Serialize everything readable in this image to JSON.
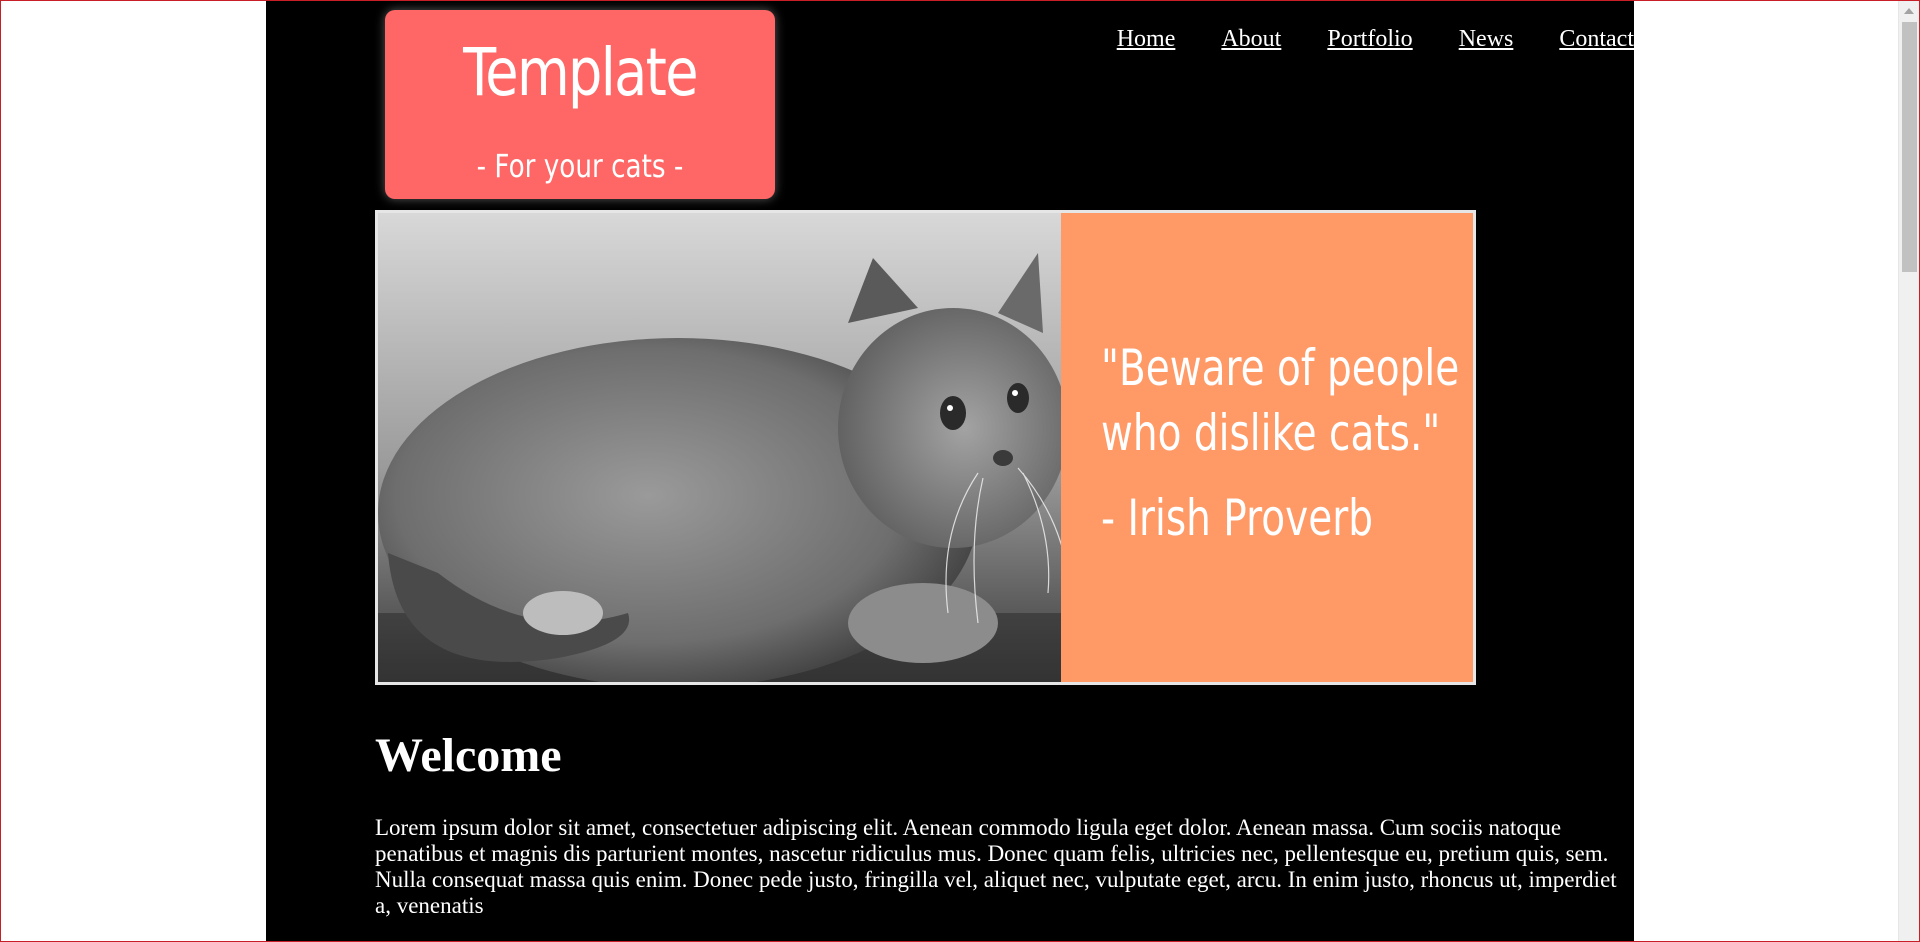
{
  "logo": {
    "title": "Template",
    "subtitle": "- For your cats -",
    "color": "#ff6666"
  },
  "nav": {
    "items": [
      {
        "label": "Home"
      },
      {
        "label": "About"
      },
      {
        "label": "Portfolio"
      },
      {
        "label": "News"
      },
      {
        "label": "Contact"
      }
    ]
  },
  "hero": {
    "quote_line1": "\"Beware of people",
    "quote_line2": "who dislike cats.\"",
    "quote_author": "- Irish Proverb",
    "panel_color": "#ff9966"
  },
  "content": {
    "heading": "Welcome",
    "paragraph": "Lorem ipsum dolor sit amet, consectetuer adipiscing elit. Aenean commodo ligula eget dolor. Aenean massa. Cum sociis natoque penatibus et magnis dis parturient montes, nascetur ridiculus mus. Donec quam felis, ultricies nec, pellentesque eu, pretium quis, sem. Nulla consequat massa quis enim. Donec pede justo, fringilla vel, aliquet nec, vulputate eget, arcu. In enim justo, rhoncus ut, imperdiet a, venenatis"
  }
}
